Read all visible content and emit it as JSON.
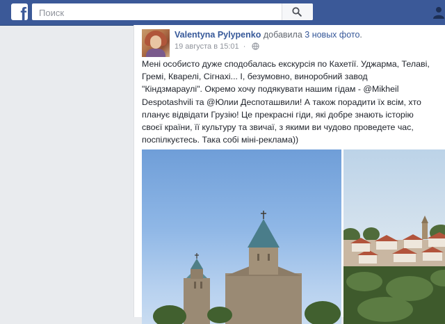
{
  "colors": {
    "topbar": "#3b5998",
    "link": "#365899",
    "text": "#1d2129",
    "meta": "#90949c",
    "page_bg": "#e9ebee"
  },
  "topbar": {
    "logo_letter": "f",
    "search_placeholder": "Поиск",
    "search_icon": "magnifier-icon"
  },
  "post": {
    "author": "Valentyna Pylypenko",
    "action_prefix": "добавила",
    "action_link": "3 новых фото",
    "action_suffix": ".",
    "timestamp": "19 августа в 15:01",
    "separator": "·",
    "privacy_icon": "globe-icon",
    "text": "Мені особисто дуже сподобалась екскурсія по Кахетії. Уджарма, Телаві,\nГремі, Кварелі, Сігнахі... І, безумовно, виноробний завод\n\"Кіндзмараулі\". Окремо хочу подякувати нашим гідам - @Mikheil\nDespotashvili та @Юлии Деспоташвили! А також порадити їх всім, хто\nпланує відвідати Грузію! Це прекрасні гіди, які добре знають історію\nсвоєї країни, її культуру та звичаї, з якими ви чудово проведете час,\nпоспілкуєтесь. Така собі міні-реклама))"
  }
}
